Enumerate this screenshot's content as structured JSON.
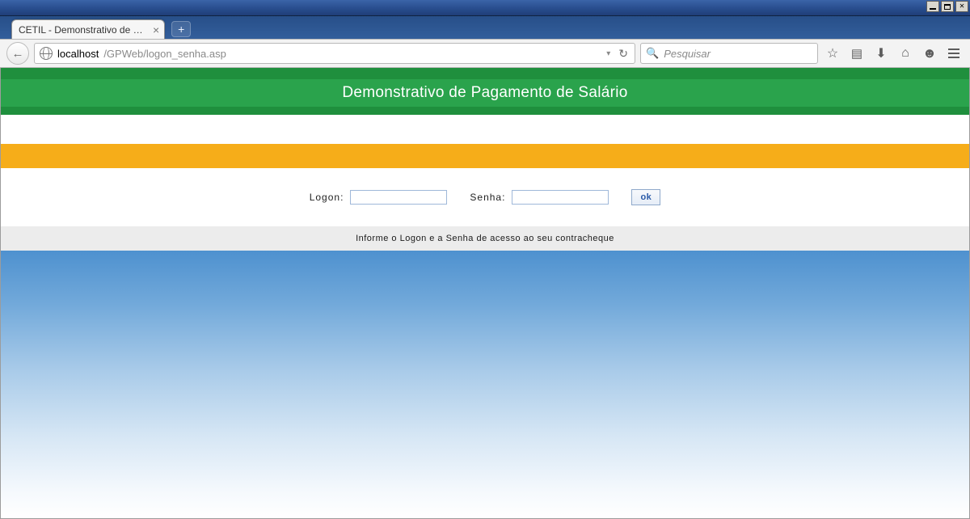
{
  "window": {
    "tab_title": "CETIL - Demonstrativo de Pageme..."
  },
  "toolbar": {
    "url_host": "localhost",
    "url_path": "/GPWeb/logon_senha.asp",
    "search_placeholder": "Pesquisar"
  },
  "page": {
    "header_title": "Demonstrativo de Pagamento de Salário",
    "login": {
      "logon_label": "Logon:",
      "senha_label": "Senha:",
      "logon_value": "",
      "senha_value": "",
      "submit_label": "ok"
    },
    "hint": "Informe o Logon e a Senha de acesso ao seu contracheque"
  }
}
